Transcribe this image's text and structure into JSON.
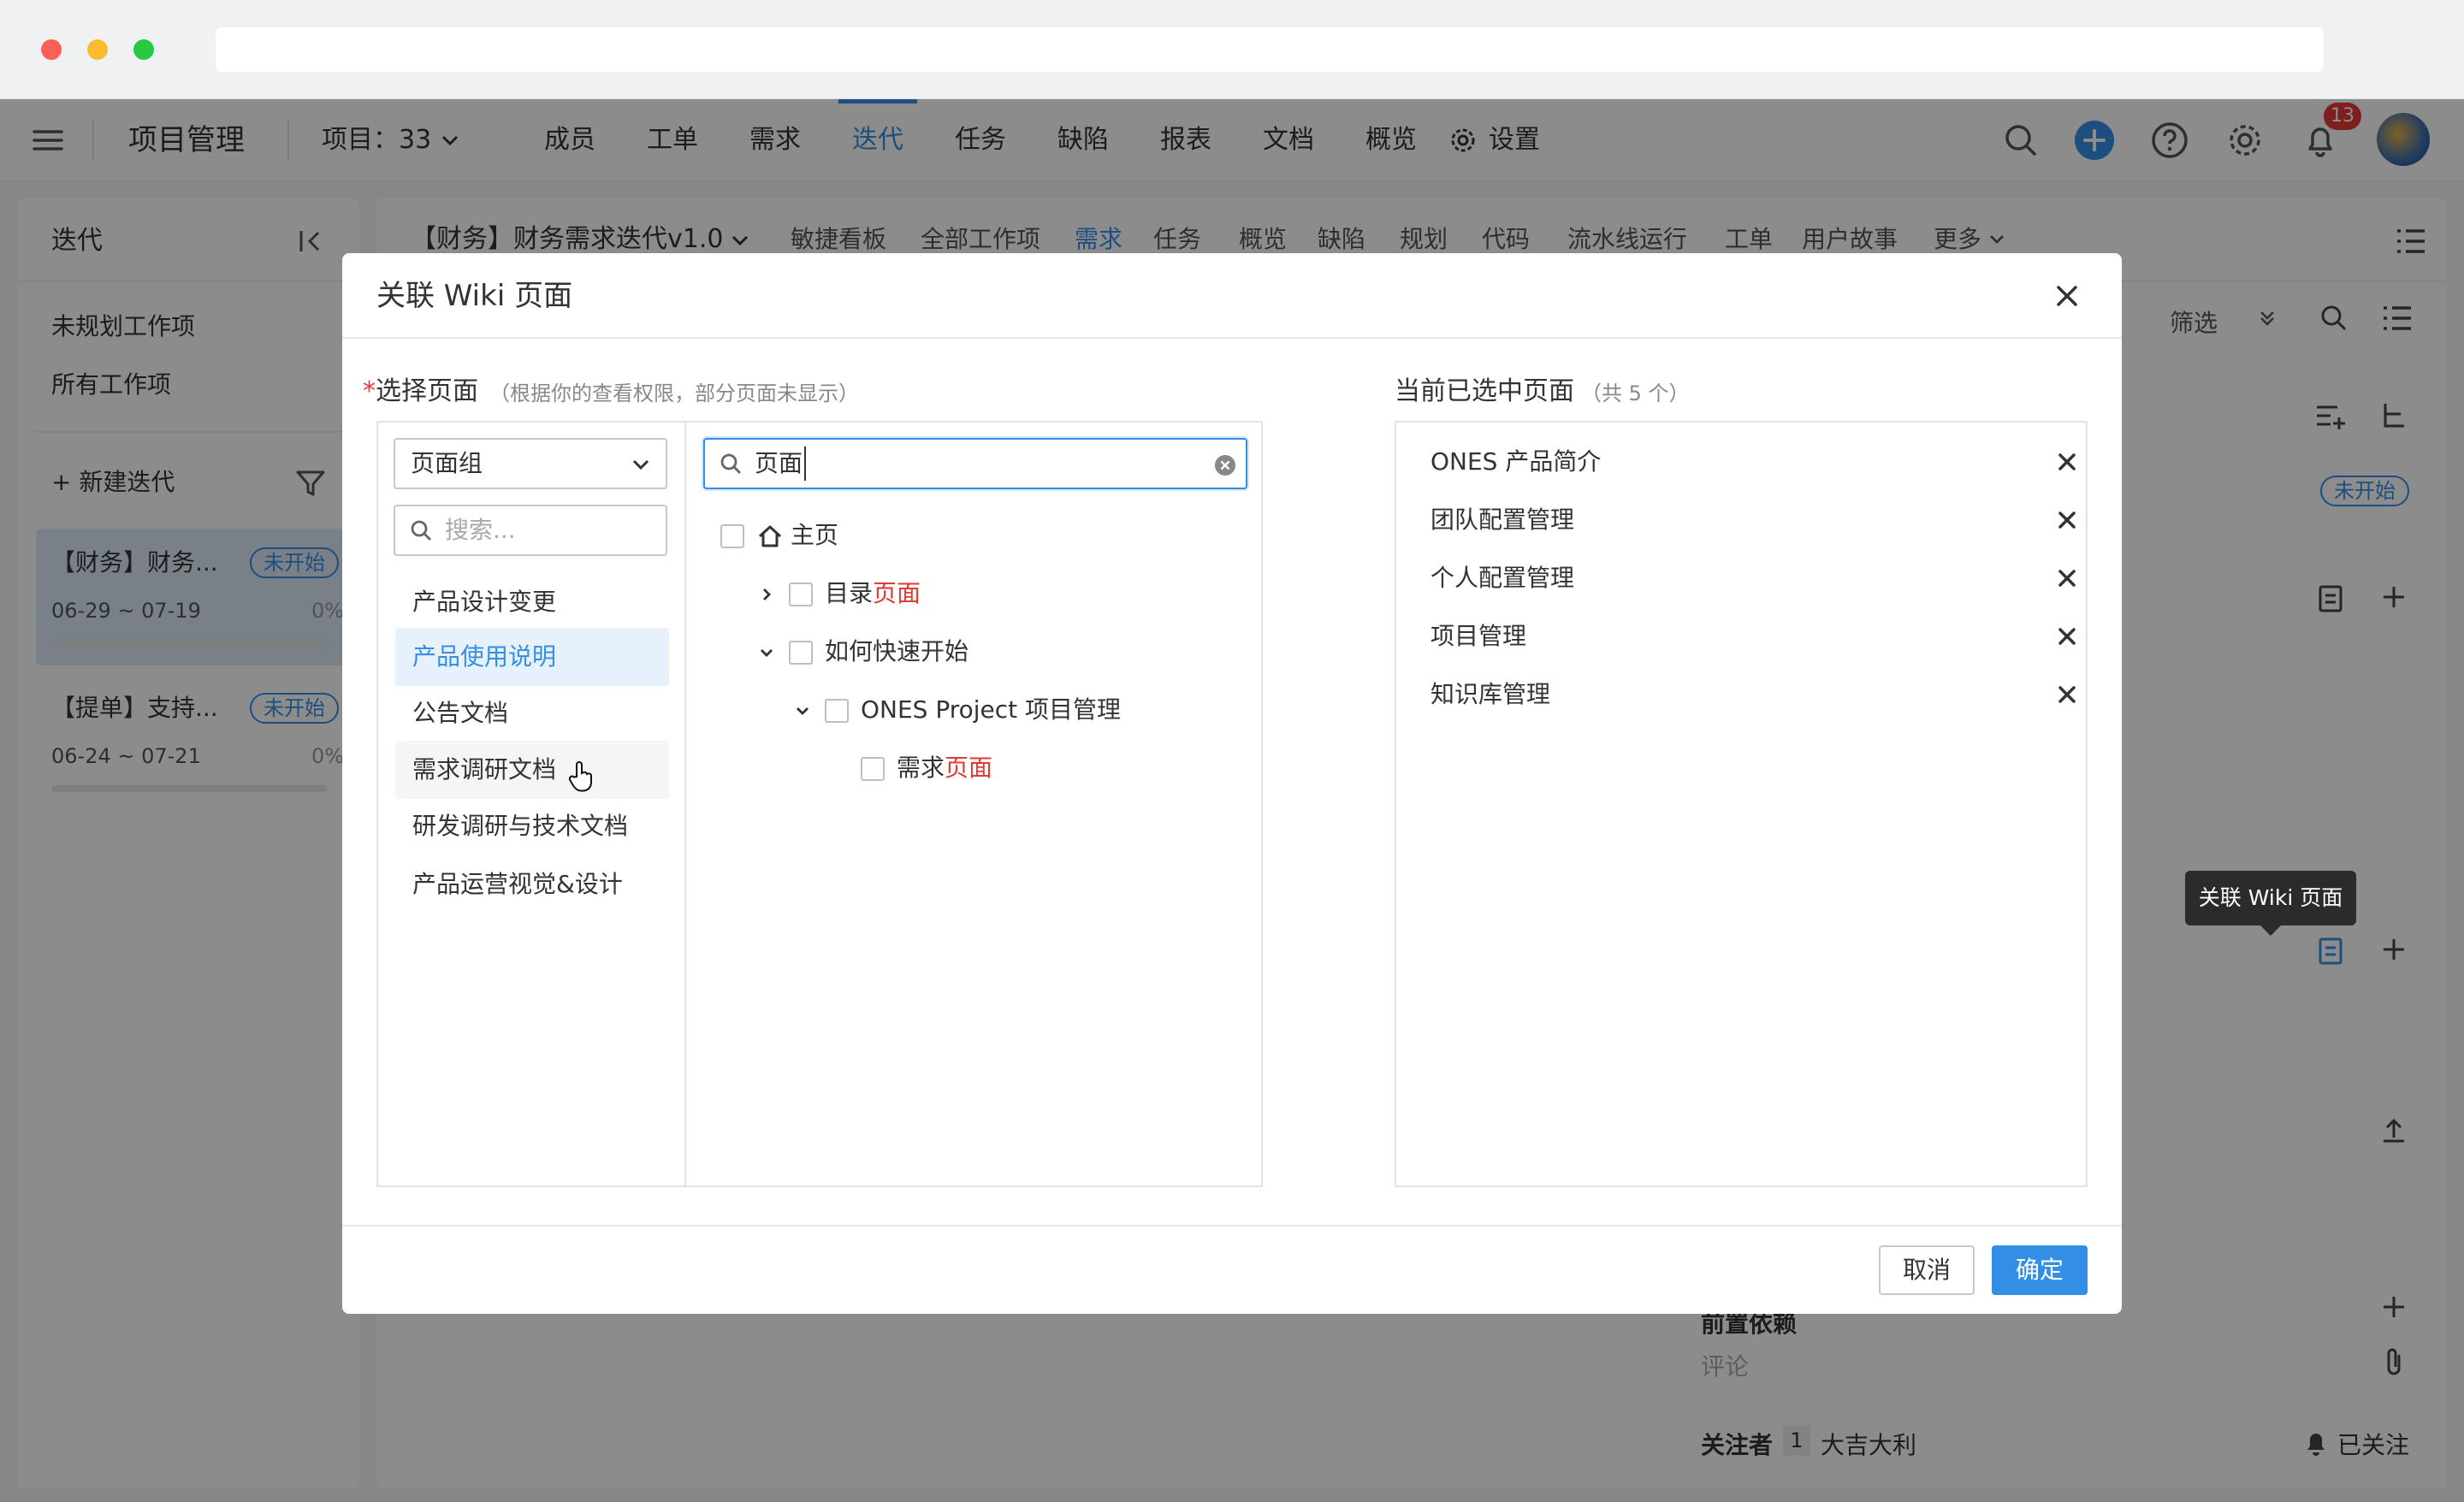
{
  "app": {
    "title": "项目管理",
    "project_selector": "项目：33",
    "nav_tabs": [
      "成员",
      "工单",
      "需求",
      "迭代",
      "任务",
      "缺陷",
      "报表",
      "文档",
      "概览",
      "设置"
    ],
    "active_tab": "迭代",
    "notification_count": "13",
    "accent_color": "#338fe5"
  },
  "sidebar": {
    "title": "迭代",
    "links": [
      "未规划工作项",
      "所有工作项"
    ],
    "new_iteration": "新建迭代",
    "iterations": [
      {
        "name": "【财务】财务...",
        "status": "未开始",
        "dates": "06-29 ~ 07-19",
        "progress": "0%"
      },
      {
        "name": "【提单】支持...",
        "status": "未开始",
        "dates": "06-24 ~ 07-21",
        "progress": "0%"
      }
    ]
  },
  "main": {
    "iteration_title": "【财务】财务需求迭代v1.0",
    "sub_tabs": [
      "敏捷看板",
      "全部工作项",
      "需求",
      "任务",
      "概览",
      "缺陷",
      "规划",
      "代码",
      "流水线运行",
      "工单",
      "用户故事",
      "更多"
    ],
    "active_sub_tab": "需求",
    "filter_label": "筛选",
    "status_badge": "未开始",
    "comment_placeholder": "评论",
    "watchers_label": "关注者",
    "watchers_count": "1",
    "watcher_name": "大吉大利",
    "followed_label": "已关注",
    "partial_label": "前置依赖"
  },
  "tooltip": "关联 Wiki 页面",
  "modal": {
    "title": "关联 Wiki 页面",
    "select_label": "选择页面",
    "select_hint": "（根据你的查看权限，部分页面未显示）",
    "group_select_value": "页面组",
    "group_search_placeholder": "搜索...",
    "groups": [
      "产品设计变更",
      "产品使用说明",
      "公告文档",
      "需求调研文档",
      "研发调研与技术文档",
      "产品运营视觉&设计"
    ],
    "selected_group": "产品使用说明",
    "page_search_value": "页面",
    "tree": [
      {
        "label": "主页",
        "highlight": ""
      },
      {
        "label": "目录",
        "highlight": "页面"
      },
      {
        "label": "如何快速开始",
        "highlight": ""
      },
      {
        "label": "ONES Project 项目管理",
        "highlight": ""
      },
      {
        "label": "需求",
        "highlight": "页面"
      }
    ],
    "selected_title": "当前已选中页面",
    "selected_count": "（共 5 个）",
    "selected_pages": [
      "ONES 产品简介",
      "团队配置管理",
      "个人配置管理",
      "项目管理",
      "知识库管理"
    ],
    "cancel_label": "取消",
    "confirm_label": "确定"
  }
}
